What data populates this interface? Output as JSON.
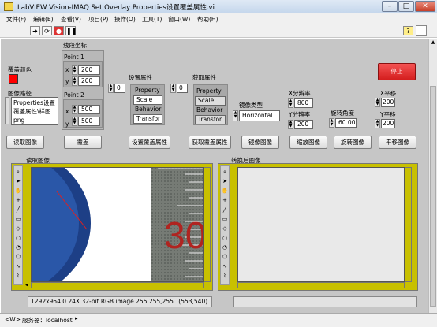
{
  "window": {
    "title": "LabVIEW Vision-IMAQ Set Overlay Properties设置覆盖属性.vi",
    "minimize": "–",
    "maximize": "□",
    "close": "✕"
  },
  "menu": [
    "文件(F)",
    "编辑(E)",
    "查看(V)",
    "项目(P)",
    "操作(O)",
    "工具(T)",
    "窗口(W)",
    "帮助(H)"
  ],
  "toolbar": {
    "help": "?"
  },
  "overlay_color": {
    "label": "覆盖颜色",
    "color": "#ff0000"
  },
  "image_path": {
    "label": "图像路径",
    "value": "Properties设置覆盖属性\\样图.png",
    "icon": "path-browse-icon"
  },
  "line_coords": {
    "label": "线段坐标",
    "point1": {
      "label": "Point 1",
      "x_label": "x",
      "x": "200",
      "y_label": "y",
      "y": "200"
    },
    "point2": {
      "label": "Point 2",
      "x_label": "x",
      "x": "500",
      "y_label": "y",
      "y": "500"
    }
  },
  "set_property": {
    "label": "设置属性",
    "index": "0",
    "rows": [
      "Property",
      "Scale",
      "Behavior",
      "Transfor"
    ]
  },
  "get_property": {
    "label": "获取属性",
    "index": "0",
    "rows": [
      "Property",
      "Scale",
      "Behavior",
      "Transfor"
    ]
  },
  "mirror_type": {
    "label": "镜像类型",
    "value": "Horizontal"
  },
  "x_resolution": {
    "label": "X分辨率",
    "value": "800"
  },
  "y_resolution": {
    "label": "Y分辨率",
    "value": "200"
  },
  "rotation_angle": {
    "label": "旋转角度",
    "value": "60.00"
  },
  "x_translate": {
    "label": "X平移",
    "value": "200"
  },
  "y_translate": {
    "label": "Y平移",
    "value": "200"
  },
  "stop_button": "停止",
  "buttons": {
    "read_image": "读取图像",
    "overlay": "覆盖",
    "set_overlay_property": "设置覆盖属性",
    "get_overlay_property": "获取覆盖属性",
    "mirror_image": "镜像图像",
    "scale_image": "缩放图像",
    "rotate_image": "旋转图像",
    "translate_image": "平移图像"
  },
  "display_left": {
    "label": "读取图像",
    "info": "1292x964 0.24X 32-bit RGB image 255,255,255",
    "coords": "(553,540)",
    "tick_text": "30"
  },
  "display_right": {
    "label": "转换后图像"
  },
  "status": {
    "target": "<W>",
    "server": "服务器：localhost"
  },
  "colors": {
    "panel": "#c6c6c6",
    "yellow": "#c8c000",
    "stop": "#ec2a2a"
  }
}
